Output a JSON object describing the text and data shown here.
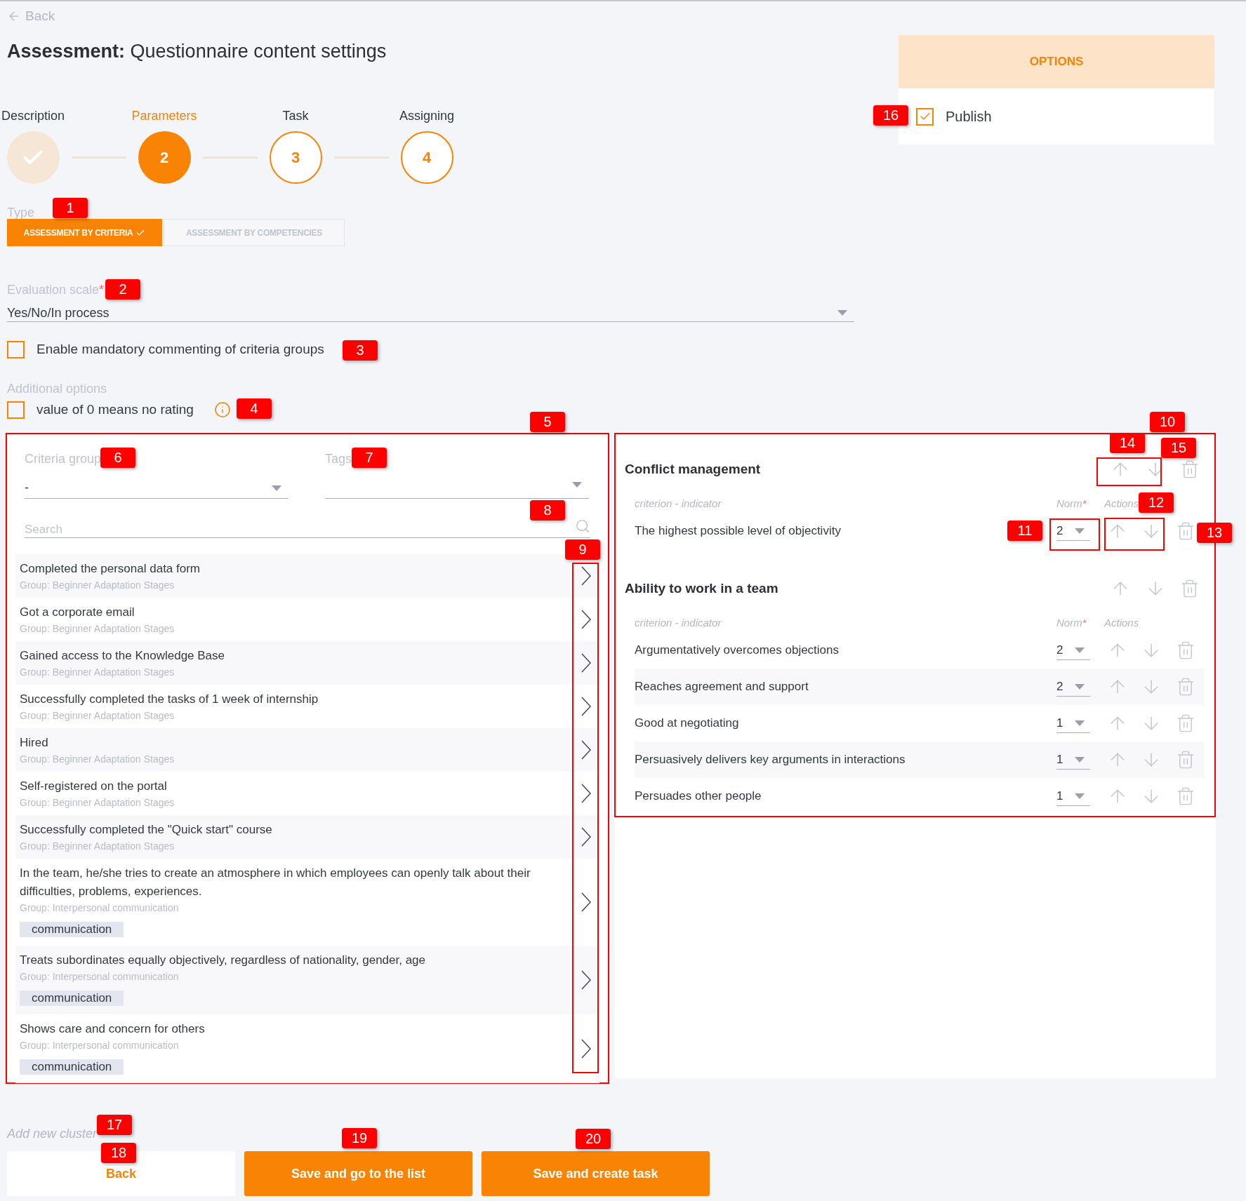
{
  "back_link": "Back",
  "title": "**Assessment:** Questionnaire content settings",
  "steps": [
    {
      "label": "Description",
      "done": true,
      "selected": false
    },
    {
      "label": "Parameters",
      "number": "2",
      "done": false,
      "selected": true
    },
    {
      "label": "Task",
      "number": "3",
      "done": false,
      "selected": false
    },
    {
      "label": "Assigning",
      "number": "4",
      "done": false,
      "selected": false
    }
  ],
  "type": {
    "label": "Type",
    "options": [
      {
        "label": "ASSESSMENT BY CRITERIA",
        "selected": true
      },
      {
        "label": "ASSESSMENT BY COMPETENCIES",
        "selected": false
      }
    ]
  },
  "evaluation_scale": {
    "label": "Evaluation scale",
    "required_mark": "*",
    "value": "Yes/No/In process"
  },
  "mandatory_commenting": {
    "label": "Enable mandatory commenting of criteria groups",
    "checked": false
  },
  "additional_options": {
    "label": "Additional options",
    "options": [
      {
        "label": "value of 0 means no rating",
        "checked": false
      }
    ]
  },
  "options_panel": {
    "title": "OPTIONS",
    "publish": {
      "label": "Publish",
      "checked": true
    }
  },
  "criteria_filter": {
    "criteria_group": {
      "label": "Criteria group",
      "value": "-"
    },
    "tags": {
      "label": "Tags"
    },
    "search": {
      "placeholder": "Search"
    }
  },
  "criteria_list": [
    {
      "title": "Completed the personal data form",
      "group": "Group: Beginner Adaptation Stages"
    },
    {
      "title": "Got a corporate email",
      "group": "Group: Beginner Adaptation Stages"
    },
    {
      "title": "Gained access to the Knowledge Base",
      "group": "Group: Beginner Adaptation Stages"
    },
    {
      "title": "Successfully completed the tasks of 1 week of internship",
      "group": "Group: Beginner Adaptation Stages"
    },
    {
      "title": "Hired",
      "group": "Group: Beginner Adaptation Stages"
    },
    {
      "title": "Self-registered on the portal",
      "group": "Group: Beginner Adaptation Stages"
    },
    {
      "title": "Successfully completed the \"Quick start\" course",
      "group": "Group: Beginner Adaptation Stages"
    },
    {
      "title": "In the team, he/she tries to create an atmosphere in which employees can openly talk about their difficulties, problems, experiences.",
      "group": "Group: Interpersonal communication",
      "tag": "communication"
    },
    {
      "title": "Treats subordinates equally objectively, regardless of nationality, gender, age",
      "group": "Group: Interpersonal communication",
      "tag": "communication"
    },
    {
      "title": "Shows care and concern for others",
      "group": "Group: Interpersonal communication",
      "tag": "communication"
    }
  ],
  "clusters": [
    {
      "title": "Conflict management",
      "columns": {
        "criterion": "criterion - indicator",
        "norm": "Norm",
        "norm_mark": "*",
        "actions": "Actions"
      },
      "items": [
        {
          "text": "The highest possible level of objectivity",
          "norm": "2"
        }
      ]
    },
    {
      "title": "Ability to work in a team",
      "columns": {
        "criterion": "criterion - indicator",
        "norm": "Norm",
        "norm_mark": "*",
        "actions": "Actions"
      },
      "items": [
        {
          "text": "Argumentatively overcomes objections",
          "norm": "2"
        },
        {
          "text": "Reaches agreement and support",
          "norm": "2"
        },
        {
          "text": "Good at negotiating",
          "norm": "1"
        },
        {
          "text": "Persuasively delivers key arguments in interactions",
          "norm": "1"
        },
        {
          "text": "Persuades other people",
          "norm": "1"
        }
      ]
    }
  ],
  "add_cluster": "Add new cluster",
  "buttons": [
    {
      "label": "Back",
      "kind": "secondary"
    },
    {
      "label": "Save and go to the list",
      "kind": "primary"
    },
    {
      "label": "Save and create task",
      "kind": "primary"
    }
  ],
  "annotations": [
    {
      "label": "1"
    },
    {
      "label": "2"
    },
    {
      "label": "3"
    },
    {
      "label": "4"
    },
    {
      "label": "5"
    },
    {
      "label": "6"
    },
    {
      "label": "7"
    },
    {
      "label": "8"
    },
    {
      "label": "9"
    },
    {
      "label": "10"
    },
    {
      "label": "11"
    },
    {
      "label": "12"
    },
    {
      "label": "13"
    },
    {
      "label": "14"
    },
    {
      "label": "15"
    },
    {
      "label": "16"
    },
    {
      "label": "17"
    },
    {
      "label": "18"
    },
    {
      "label": "19"
    },
    {
      "label": "20"
    }
  ]
}
